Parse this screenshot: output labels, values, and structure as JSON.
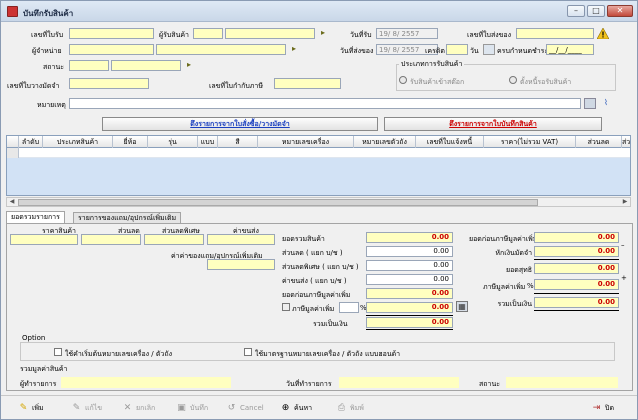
{
  "window": {
    "title": "บันทึกรับสินค้า",
    "min_label": "–",
    "max_label": "□",
    "close_label": "✕"
  },
  "header": {
    "receipt_no_label": "เลขที่ใบรับ",
    "receiver_label": "ผู้รับสินค้า",
    "receive_date_label": "วันที่รับ",
    "receive_date_value": "19/ 8/ 2557",
    "delivery_no_label": "เลขที่ใบส่งของ",
    "vendor_label": "ผู้จำหน่าย",
    "delivery_date_label": "วันที่ส่งของ",
    "delivery_date_value": "19/ 8/ 2557",
    "credit_label": "เครดิต",
    "credit_unit": "วัน",
    "due_date_label": "ครบกำหนดชำระ",
    "due_date_value": "__/__/____",
    "status_label": "สถานะ",
    "location_label": "เลขที่ใบวางมัดจำ",
    "deposit_no_label": "เลขที่ใบกำกับภาษี",
    "receive_type_label": "ประเภทการรับสินค้า",
    "radio1_label": "รับสินค้าเข้าสต๊อก",
    "radio2_label": "ตั้งหนี้รอรับสินค้า",
    "remark_label": "หมายเหตุ"
  },
  "actions": {
    "pull_order_label": "ดึงรายการจากใบสั่งซื้อ/วางมัดจำ",
    "pull_receipt_label": "ดึงรายการจากใบบันทึกสินค้า"
  },
  "grid": {
    "columns": [
      "ลำดับ",
      "ประเภทสินค้า",
      "ยี่ห้อ",
      "รุ่น",
      "แบบ",
      "สี",
      "หมายเลขเครื่อง",
      "หมายเลขตัวถัง",
      "เลขที่ใบแจ้งหนี้",
      "ราคา(ไม่รวม VAT)",
      "ส่วนลด",
      "ส่ว"
    ]
  },
  "tabs": [
    "ยอดรวมรายการ",
    "รายการของแถม/อุปกรณ์เพิ่มเติม"
  ],
  "summary": {
    "col_price": "ราคาสินค้า",
    "col_discount": "ส่วนลด",
    "col_special": "ส่วนลดพิเศษ",
    "col_shipping": "ค่าขนส่ง",
    "extras_label": "ค่าค่าของแถม/อุปกรณ์เพิ่มเติม",
    "goods_total_label": "ยอดรวมสินค้า",
    "discount_label": "ส่วนลด ( แยก บ/ช )",
    "special_label": "ส่วนลดพิเศษ ( แยก บ/ช )",
    "shipping_label": "ค่าขนส่ง ( แยก บ/ช )",
    "before_vat_label": "ยอดก่อนภาษีมูลค่าเพิ่ม",
    "vat_label": "ภาษีมูลค่าเพิ่ม",
    "vat_pct_sign": "%",
    "total_label": "รวมเป็นเงิน",
    "right_before_vat_label": "ยอดก่อนภาษีมูลค่าเพิ่ม",
    "deduct_deposit_label": "หักเงินมัดจำ",
    "net_label": "ยอดสุทธิ",
    "right_vat_label": "ภาษีมูลค่าเพิ่ม",
    "right_total_label": "รวมเป็นเงิน",
    "values": {
      "goods_total": "0.00",
      "discount": "0.00",
      "special": "0.00",
      "shipping": "0.00",
      "before_vat": "0.00",
      "vat": "0.00",
      "total": "0.00",
      "right_before_vat": "0.00",
      "deduct_deposit": "0.00",
      "net": "0.00",
      "right_vat": "0.00",
      "right_total": "0.00"
    }
  },
  "option": {
    "title": "Option",
    "opt1": "ใช้คำเริ่มต้นหมายเลขเครื่อง / ตัวถัง",
    "opt2": "ใช้มาตรฐานหมายเลขเครื่อง / ตัวถัง แบบฮอนด้า",
    "sum_label": "รวมมูลค่าสินค้า"
  },
  "footer": {
    "creator_label": "ผู้ทำรายการ",
    "created_date_label": "วันที่ทำรายการ",
    "state_label": "สถานะ"
  },
  "toolbar": {
    "add": "เพิ่ม",
    "edit": "แก้ไข",
    "cancel_doc": "ยกเลิก",
    "save": "บันทึก",
    "cancel": "Cancel",
    "search": "ค้นหา",
    "print": "พิมพ์",
    "close": "ปิด"
  }
}
